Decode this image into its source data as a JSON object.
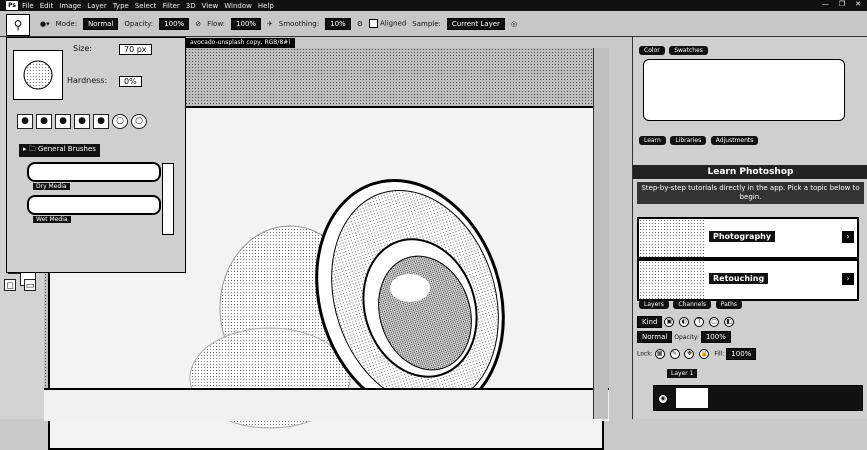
{
  "menu": {
    "logo": "Ps",
    "items": [
      "File",
      "Edit",
      "Image",
      "Layer",
      "Type",
      "Select",
      "Filter",
      "3D",
      "View",
      "Window",
      "Help"
    ]
  },
  "options": {
    "mode_label": "Mode:",
    "mode_value": "Normal",
    "opacity_label": "Opacity:",
    "opacity_value": "100%",
    "flow_label": "Flow:",
    "flow_value": "100%",
    "smoothing_label": "Smoothing:",
    "smoothing_value": "10%",
    "sample_label": "Sample:",
    "sample_value": "Current Layer",
    "aligned_label": "Aligned"
  },
  "document": {
    "tab_title": "avocado-unsplash copy, RGB/8#)"
  },
  "brush_panel": {
    "size_label": "Size:",
    "size_value": "70 px",
    "hardness_label": "Hardness:",
    "hardness_value": "0%",
    "groups": [
      "General Brushes",
      "Dry Media"
    ],
    "general_brushes": "General Brushes",
    "dry_media": "Dry Media",
    "wet_media": "Wet Media"
  },
  "right_panel": {
    "tabs_top": [
      "Color",
      "Swatches"
    ],
    "tabs_mid": [
      "Learn",
      "Libraries",
      "Adjustments"
    ],
    "learn_title": "Learn Photoshop",
    "learn_desc": "Step-by-step tutorials directly in the app. Pick a topic below to begin.",
    "tutorials": [
      "Photography",
      "Retouching"
    ],
    "tabs_bottom": [
      "Layers",
      "Channels",
      "Paths"
    ],
    "kind_label": "Kind",
    "blend_label": "Normal",
    "opacity_label": "Opacity:",
    "opacity_value": "100%",
    "lock_label": "Lock:",
    "fill_label": "Fill:",
    "fill_value": "100%",
    "layer_name": "Layer 1"
  }
}
